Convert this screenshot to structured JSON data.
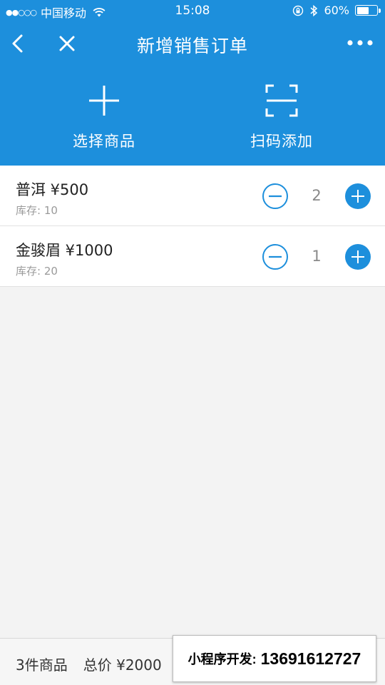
{
  "status_bar": {
    "signal": "●●○○○",
    "carrier": "中国移动",
    "time": "15:08",
    "battery_percent": "60%",
    "battery_level": 0.6
  },
  "nav": {
    "title": "新增销售订单",
    "back_icon": "chevron-left-icon",
    "close_icon": "close-icon",
    "more_icon": "more-dots-icon"
  },
  "actions": {
    "select": {
      "label": "选择商品",
      "icon": "plus-icon"
    },
    "scan": {
      "label": "扫码添加",
      "icon": "scan-frame-icon"
    }
  },
  "products": [
    {
      "name": "普洱 ¥500",
      "stock": "库存: 10",
      "qty": "2"
    },
    {
      "name": "金骏眉 ¥1000",
      "stock": "库存: 20",
      "qty": "1"
    }
  ],
  "footer": {
    "count": "3件商品",
    "total": "总价 ¥2000"
  },
  "promo": {
    "label": "小程序开发:",
    "phone": "13691612727"
  },
  "colors": {
    "primary": "#1d8fdc",
    "background": "#f3f3f3",
    "white": "#ffffff"
  }
}
